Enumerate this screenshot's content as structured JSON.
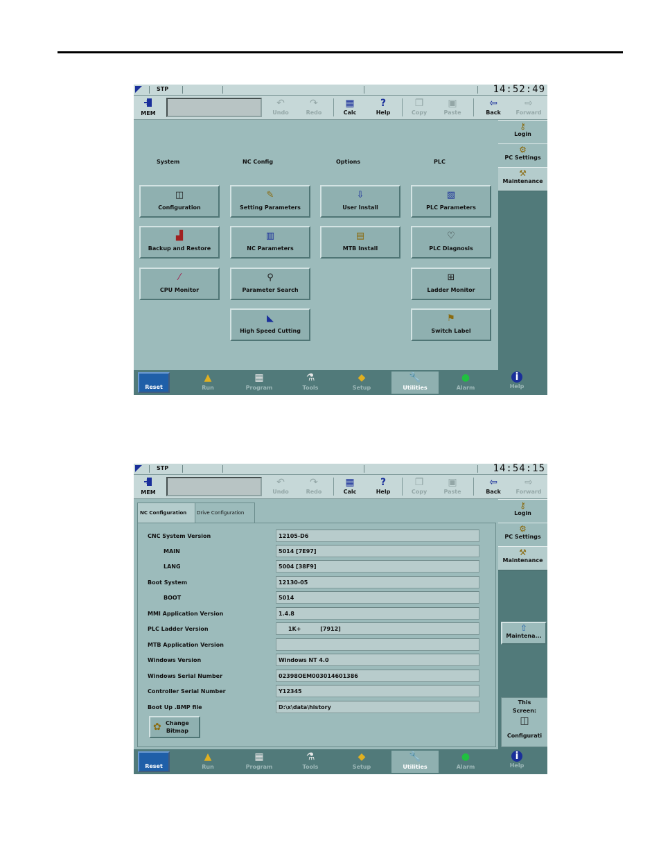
{
  "status": {
    "mode": "STP",
    "clock_top": "14:52:49",
    "clock_bottom": "14:54:15"
  },
  "toolbar": {
    "mem": "MEM",
    "undo": "Undo",
    "redo": "Redo",
    "calc": "Calc",
    "help": "Help",
    "copy": "Copy",
    "paste": "Paste",
    "back": "Back",
    "forward": "Forward"
  },
  "side": {
    "login": "Login",
    "pc_settings": "PC Settings",
    "maintenance": "Maintenance"
  },
  "bottom": {
    "reset": "Reset",
    "run": "Run",
    "program": "Program",
    "tools": "Tools",
    "setup": "Setup",
    "utilities": "Utilities",
    "alarm": "Alarm",
    "help": "Help"
  },
  "utilities": {
    "headers": {
      "system": "System",
      "nc_config": "NC Config",
      "options": "Options",
      "plc": "PLC"
    },
    "buttons": {
      "configuration": "Configuration",
      "backup_restore": "Backup and Restore",
      "cpu_monitor": "CPU Monitor",
      "setting_parameters": "Setting Parameters",
      "nc_parameters": "NC Parameters",
      "parameter_search": "Parameter Search",
      "high_speed_cutting": "High Speed Cutting",
      "user_install": "User Install",
      "mtb_install": "MTB Install",
      "plc_parameters": "PLC Parameters",
      "plc_diagnosis": "PLC Diagnosis",
      "ladder_monitor": "Ladder Monitor",
      "switch_label": "Switch Label"
    }
  },
  "config": {
    "tabs": {
      "nc": "NC Configuration",
      "drive": "Drive Configuration"
    },
    "rows": [
      {
        "label": "CNC System Version",
        "value": "12105-D6"
      },
      {
        "label": "MAIN",
        "value": "5014 [7E97]"
      },
      {
        "label": "LANG",
        "value": "5004 [38F9]"
      },
      {
        "label": "Boot System",
        "value": "12130-05"
      },
      {
        "label": "BOOT",
        "value": "5014"
      },
      {
        "label": "MMI Application Version",
        "value": "1.4.8"
      },
      {
        "label": "PLC Ladder Version",
        "value": "     1K+          [7912]"
      },
      {
        "label": "MTB Application Version",
        "value": ""
      },
      {
        "label": "Windows Version",
        "value": "Windows NT 4.0"
      },
      {
        "label": "Windows Serial Number",
        "value": "02398OEM003014601386"
      },
      {
        "label": "Controller Serial Number",
        "value": "Y12345"
      },
      {
        "label": "Boot Up .BMP file",
        "value": "D:\\x\\data\\history"
      }
    ],
    "change_bitmap_1": "Change",
    "change_bitmap_2": "Bitmap",
    "maint_button": "Maintena...",
    "this_screen_1": "This",
    "this_screen_2": "Screen:",
    "this_screen_name": "Configurati"
  }
}
